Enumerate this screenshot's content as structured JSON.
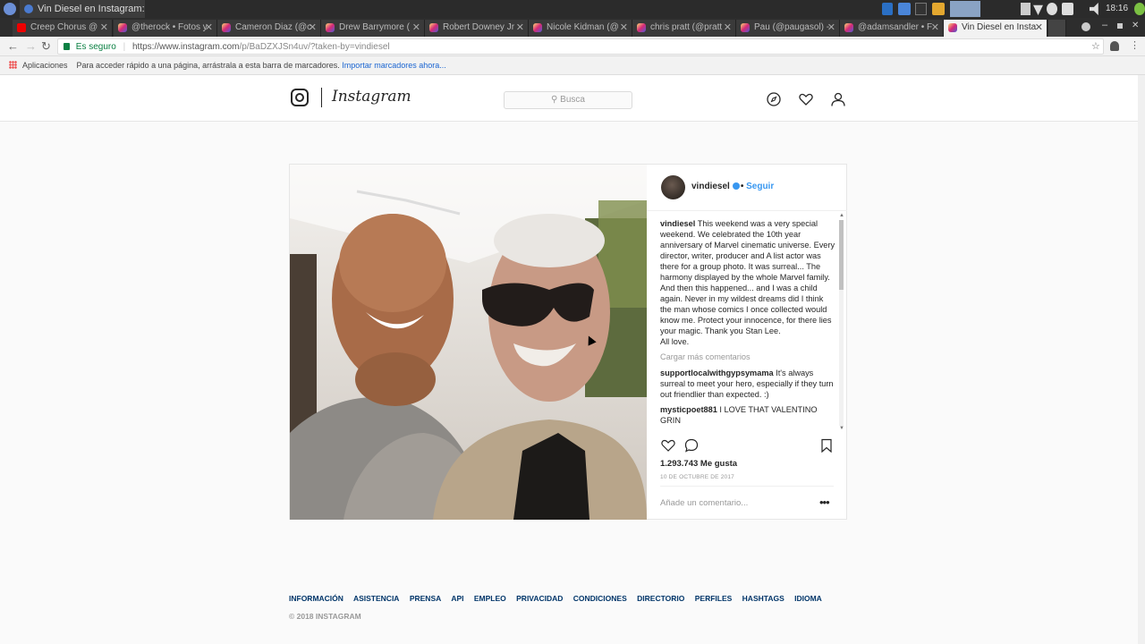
{
  "os": {
    "active_window_title": "Vin Diesel en Instagram: “T...",
    "clock": "18:16"
  },
  "browser": {
    "tabs": [
      {
        "label": "Creep Chorus @",
        "type": "youtube",
        "muted_icon": "🔈"
      },
      {
        "label": "@therock • Fotos y",
        "type": "instagram"
      },
      {
        "label": "Cameron Diaz (@c",
        "type": "instagram"
      },
      {
        "label": "Drew Barrymore (",
        "type": "instagram"
      },
      {
        "label": "Robert Downey Jr",
        "type": "instagram"
      },
      {
        "label": "Nicole Kidman (@",
        "type": "instagram"
      },
      {
        "label": "chris pratt (@pratt",
        "type": "instagram"
      },
      {
        "label": "Pau (@paugasol) -",
        "type": "instagram"
      },
      {
        "label": "@adamsandler • F",
        "type": "instagram"
      },
      {
        "label": "Vin Diesel en Insta",
        "type": "instagram",
        "active": true
      }
    ],
    "secure_label": "Es seguro",
    "url_main": "https://www.instagram.com",
    "url_path": "/p/BaDZXJSn4uv/?taken-by=vindiesel",
    "bookmarks": {
      "apps_label": "Aplicaciones",
      "hint": "Para acceder rápido a una página, arrástrala a esta barra de marcadores.",
      "import_link": "Importar marcadores ahora..."
    }
  },
  "instagram": {
    "wordmark": "Instagram",
    "search_placeholder": "Busca",
    "post": {
      "username": "vindiesel",
      "follow_label": "Seguir",
      "dot_sep": "•",
      "caption_user": "vindiesel",
      "caption_text": "This weekend was a very special weekend. We celebrated the 10th year anniversary of Marvel cinematic universe. Every director, writer, producer and A list actor was there for a group photo. It was surreal... The harmony displayed by the whole Marvel family. And then this happened... and I was a child again. Never in my wildest dreams did I think the man whose comics I once collected would know me. Protect your innocence, for there lies your magic. Thank you Stan Lee.",
      "caption_end": "All love.",
      "load_more": "Cargar más comentarios",
      "comments": [
        {
          "user": "supportlocalwithgypsymama",
          "text": "It's always surreal to meet your hero, especially if they turn out friendlier than expected. :)"
        },
        {
          "user": "mysticpoet881",
          "text": "I LOVE THAT VALENTINO GRIN"
        }
      ],
      "likes": "1.293.743 Me gusta",
      "date": "10 DE OCTUBRE DE 2017",
      "add_comment_placeholder": "Añade un comentario...",
      "more_dots": "•••"
    },
    "footer_links": [
      "INFORMACIÓN",
      "ASISTENCIA",
      "PRENSA",
      "API",
      "EMPLEO",
      "PRIVACIDAD",
      "CONDICIONES",
      "DIRECTORIO",
      "PERFILES",
      "HASHTAGS",
      "IDIOMA"
    ],
    "copyright": "© 2018 INSTAGRAM"
  }
}
